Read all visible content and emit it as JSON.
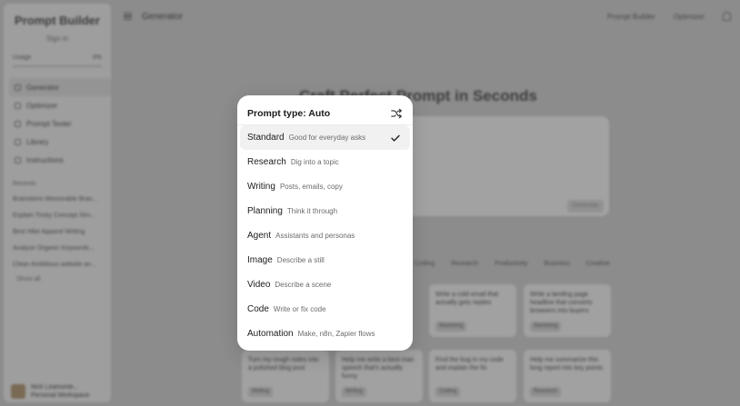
{
  "sidebar": {
    "brand": "Prompt Builder",
    "subtitle": "Sign in",
    "usage_label": "Usage",
    "usage_value": "0%",
    "nav": [
      {
        "label": "Generator",
        "icon": "grid-icon",
        "active": true
      },
      {
        "label": "Optimizer",
        "icon": "sparkle-icon",
        "active": false
      },
      {
        "label": "Prompt Tester",
        "icon": "flask-icon",
        "active": false
      },
      {
        "label": "Library",
        "icon": "book-icon",
        "active": false
      },
      {
        "label": "Instructions",
        "icon": "doc-icon",
        "active": false
      }
    ],
    "recents_title": "Recents",
    "recents": [
      "Brainstorm Memorable Bran...",
      "Explain Tricky Concept Sim...",
      "Best Hike Apparel Writing",
      "Analyze Organic Keywords...",
      "Clean Ambitious website an..."
    ],
    "show_all": "Show all",
    "user_name": "Nick Leamonte...",
    "user_sub": "Personal Workspace"
  },
  "topbar": {
    "title": "Generator",
    "right_links": [
      "Prompt Builder",
      "Optimizer"
    ]
  },
  "main": {
    "hero_title": "Craft Perfect Prompt in Seconds",
    "generate_label": "Generate",
    "chips": [
      "Coding",
      "Research",
      "Productivity",
      "Business",
      "Creative"
    ],
    "cards": [
      {
        "text": "Write a cold email that actually gets replies",
        "tag": "Marketing"
      },
      {
        "text": "Write a landing page headline that converts browsers into buyers",
        "tag": "Marketing"
      },
      {
        "text": "Turn my rough notes into a polished blog post",
        "tag": "Writing"
      },
      {
        "text": "Help me write a best man speech that's actually funny",
        "tag": "Writing"
      },
      {
        "text": "Find the bug in my code and explain the fix",
        "tag": "Coding"
      },
      {
        "text": "Help me summarize this long report into key points",
        "tag": "Research"
      }
    ]
  },
  "menu": {
    "title": "Prompt type: Auto",
    "shuffle_icon": "shuffle-icon",
    "check_icon": "check-icon",
    "options": [
      {
        "name": "Standard",
        "desc": "Good for everyday asks",
        "selected": true
      },
      {
        "name": "Research",
        "desc": "Dig into a topic",
        "selected": false
      },
      {
        "name": "Writing",
        "desc": "Posts, emails, copy",
        "selected": false
      },
      {
        "name": "Planning",
        "desc": "Think it through",
        "selected": false
      },
      {
        "name": "Agent",
        "desc": "Assistants and personas",
        "selected": false
      },
      {
        "name": "Image",
        "desc": "Describe a still",
        "selected": false
      },
      {
        "name": "Video",
        "desc": "Describe a scene",
        "selected": false
      },
      {
        "name": "Code",
        "desc": "Write or fix code",
        "selected": false
      },
      {
        "name": "Automation",
        "desc": "Make, n8n, Zapier flows",
        "selected": false
      }
    ]
  }
}
